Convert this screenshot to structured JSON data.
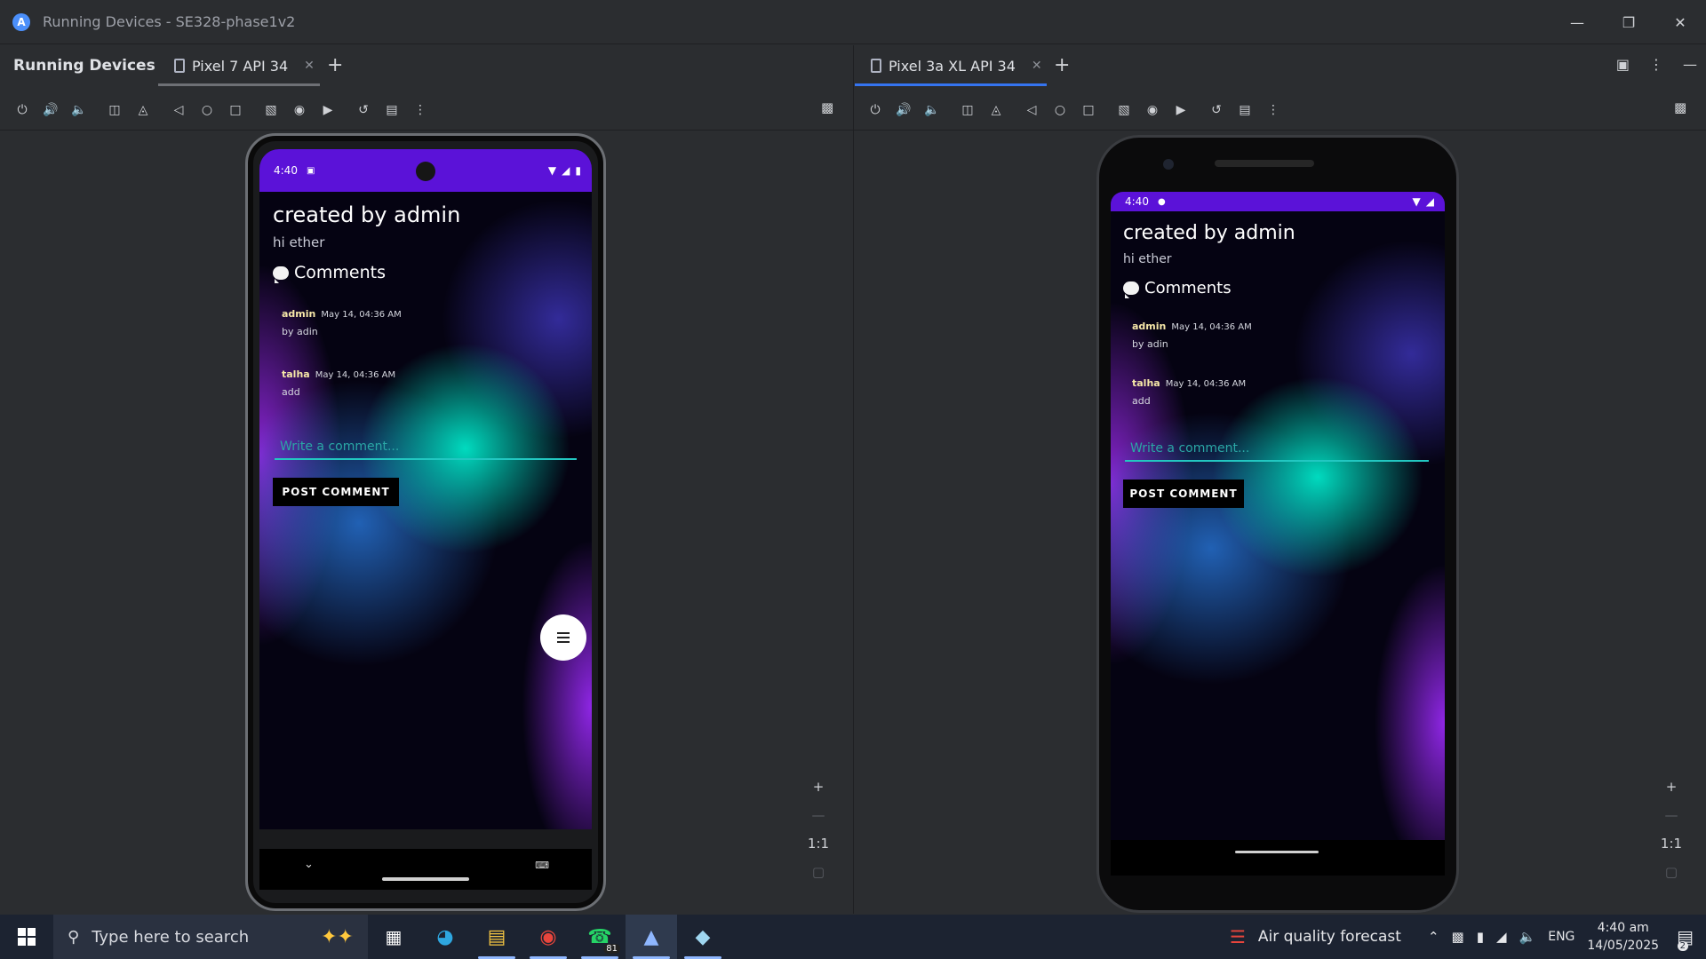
{
  "window": {
    "title": "Running Devices - SE328-phase1v2",
    "controls": [
      "minimize-icon",
      "restore-icon",
      "close-icon"
    ]
  },
  "tool_window": {
    "label": "Running Devices"
  },
  "left_panel": {
    "tab": "Pixel 7 API 34",
    "accent": "#7a7c80"
  },
  "right_panel": {
    "tab": "Pixel 3a XL API 34",
    "accent": "#3574f0"
  },
  "toolbar_icons": [
    "power-icon",
    "volume-up-icon",
    "volume-down-icon",
    "rotate-left-icon",
    "rotate-right-icon",
    "back-icon",
    "home-icon",
    "overview-icon",
    "fold-icon",
    "screenshot-icon",
    "screen-record-icon",
    "reset-icon",
    "snapshot-icon",
    "more-icon"
  ],
  "zoom": {
    "plus": "+",
    "minus": "—",
    "ratio": "1:1"
  },
  "app": {
    "status_time": "4:40",
    "post_title": "created by admin",
    "post_body": "hi ether",
    "comments_heading": "Comments",
    "comments": [
      {
        "author": "admin",
        "date": "May 14, 04:36 AM",
        "text": "by adin"
      },
      {
        "author": "talha",
        "date": "May 14, 04:36 AM",
        "text": "add"
      }
    ],
    "input_placeholder": "Write a comment...",
    "post_button": "POST COMMENT",
    "accent": "#22c7c1"
  },
  "taskbar": {
    "search_placeholder": "Type here to search",
    "whatsapp_badge": "81",
    "weather": "Air quality forecast",
    "language": "ENG",
    "time": "4:40 am",
    "date": "14/05/2025",
    "notification_count": "2"
  }
}
